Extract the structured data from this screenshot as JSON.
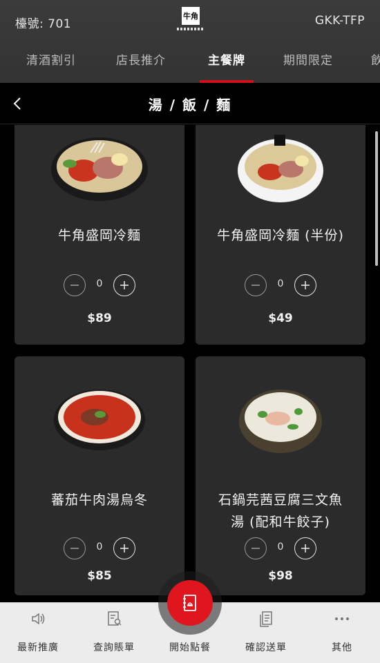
{
  "header": {
    "table_label": "檯號: 701",
    "store_code": "GKK-TFP",
    "logo_glyph": "牛角"
  },
  "tabs": [
    {
      "label": "清酒割引",
      "active": false
    },
    {
      "label": "店長推介",
      "active": false
    },
    {
      "label": "主餐牌",
      "active": true
    },
    {
      "label": "期間限定",
      "active": false
    },
    {
      "label": "飲",
      "active": false
    }
  ],
  "category": {
    "title": "湯 / 飯 / 麵",
    "back_icon": "chevron-left-icon"
  },
  "items": [
    {
      "name": "牛角盛岡冷麵",
      "qty": "0",
      "price": "$89"
    },
    {
      "name": "牛角盛岡冷麵 (半份)",
      "qty": "0",
      "price": "$49"
    },
    {
      "name": "蕃茄牛肉湯烏冬",
      "qty": "0",
      "price": "$85"
    },
    {
      "name_line1": "石鍋芫茜豆腐三文魚",
      "name_line2": "湯 (配和牛餃子)",
      "qty": "0",
      "price": "$98"
    }
  ],
  "bottom_nav": [
    {
      "label": "最新推廣",
      "icon": "speaker-icon"
    },
    {
      "label": "查詢賬單",
      "icon": "bill-search-icon"
    },
    {
      "label": "開始點餐",
      "icon": "menu-book-icon"
    },
    {
      "label": "確認送單",
      "icon": "order-list-icon"
    },
    {
      "label": "其他",
      "icon": "more-dots-icon"
    }
  ],
  "colors": {
    "accent_red": "#d0111b",
    "card_bg": "#2b2b2b",
    "header_bg": "#3b3b3b"
  }
}
